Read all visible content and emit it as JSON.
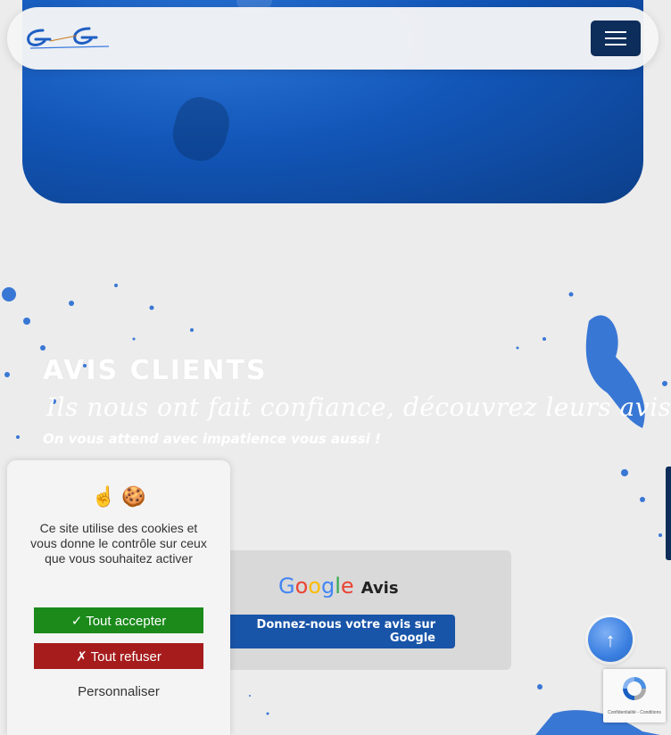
{
  "header": {
    "logo_alt": "logo",
    "menu_label": "menu"
  },
  "section": {
    "title": "AVIS CLIENTS",
    "script": "Ils nous ont fait confiance, découvrez leurs avis.",
    "subtitle": "On vous attend avec impatience vous aussi !"
  },
  "review": {
    "google_letters": [
      "G",
      "o",
      "o",
      "g",
      "l",
      "e"
    ],
    "avis_label": "Avis",
    "button_label": "Donnez-nous votre avis sur Google"
  },
  "cookie": {
    "icons": "☝ 🍪",
    "text": "Ce site utilise des cookies et vous donne le contrôle sur ceux que vous souhaitez activer",
    "accept_label": "✓ Tout accepter",
    "refuse_label": "✗ Tout refuser",
    "customize_label": "Personnaliser"
  },
  "scroll_top": {
    "icon": "➚",
    "label": "↑"
  },
  "recaptcha": {
    "links": "Confidentialité - Conditions"
  },
  "colors": {
    "accent": "#1854a8",
    "navy": "#0d2d5a",
    "accept": "#1b8a1b",
    "refuse": "#a61c1c"
  }
}
